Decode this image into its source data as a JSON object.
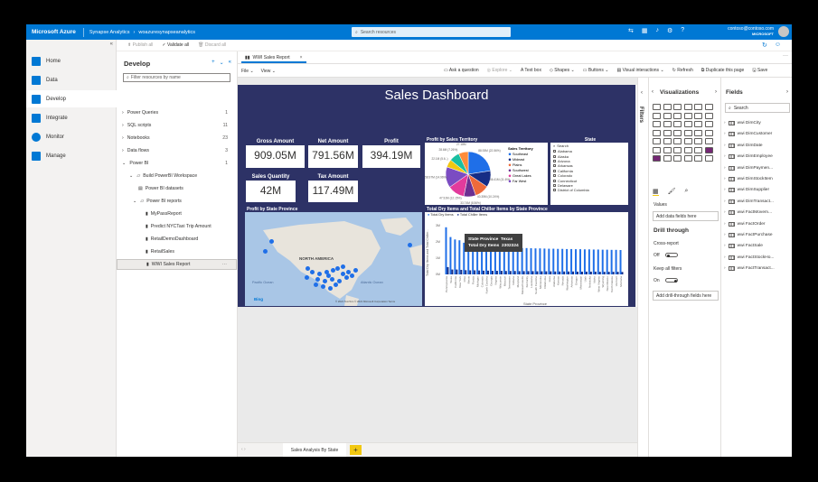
{
  "topbar": {
    "brand": "Microsoft Azure",
    "product": "Synapse Analytics",
    "workspace": "woazuresynapseanalytics",
    "search_placeholder": "Search resources",
    "user_email": "contoso@contoso.com",
    "user_directory": "MICROSOFT"
  },
  "cmdbar": {
    "publish_all": "Publish all",
    "validate_all": "Validate all",
    "discard_all": "Discard all"
  },
  "leftnav": {
    "items": [
      {
        "label": "Home",
        "icon": "home-icon"
      },
      {
        "label": "Data",
        "icon": "data-icon"
      },
      {
        "label": "Develop",
        "icon": "develop-icon"
      },
      {
        "label": "Integrate",
        "icon": "integrate-icon"
      },
      {
        "label": "Monitor",
        "icon": "monitor-icon"
      },
      {
        "label": "Manage",
        "icon": "manage-icon"
      }
    ],
    "active": "Develop"
  },
  "develop": {
    "title": "Develop",
    "filter_placeholder": "Filter resources by name",
    "tree": [
      {
        "label": "Power Queries",
        "count": "1"
      },
      {
        "label": "SQL scripts",
        "count": "11"
      },
      {
        "label": "Notebooks",
        "count": "23"
      },
      {
        "label": "Data flows",
        "count": "3"
      },
      {
        "label": "Power BI",
        "count": "1"
      },
      {
        "label": "Build PowerBI Workspace"
      },
      {
        "label": "Power BI datasets"
      },
      {
        "label": "Power BI reports"
      },
      {
        "label": "MyPassReport"
      },
      {
        "label": "Predict NYCTaxi Trip Amount"
      },
      {
        "label": "RetailDemoDashboard"
      },
      {
        "label": "RetailSales"
      },
      {
        "label": "WWI Sales Report"
      }
    ]
  },
  "report_tab": {
    "label": "WWI Sales Report"
  },
  "ribbon": {
    "file": "File",
    "view": "View",
    "ask": "Ask a question",
    "explore": "Explore",
    "textbox": "Text box",
    "shapes": "Shapes",
    "buttons": "Buttons",
    "visual_interactions": "Visual interactions",
    "refresh": "Refresh",
    "duplicate": "Duplicate this page",
    "save": "Save"
  },
  "dashboard": {
    "title": "Sales Dashboard",
    "kpis": [
      {
        "label": "Gross Amount",
        "value": "909.05M"
      },
      {
        "label": "Net Amount",
        "value": "791.56M"
      },
      {
        "label": "Profit",
        "value": "394.19M"
      },
      {
        "label": "Sales Quantity",
        "value": "42M"
      },
      {
        "label": "Tax Amount",
        "value": "117.49M"
      }
    ],
    "pie_title": "Profit by Sales Territory",
    "pie_legend_title": "Sales Territory",
    "slicer_title": "State",
    "slicer_search": "Search",
    "slicer_items": [
      "Alabama",
      "Alaska",
      "Arizona",
      "Arkansas",
      "California",
      "Colorado",
      "Connecticut",
      "Delaware",
      "District of Columbia"
    ],
    "map_title": "Profit by State Province",
    "map_labels": {
      "na": "NORTH AMERICA",
      "pac": "Pacific Ocean",
      "atl": "Atlantic Ocean",
      "bing": "Bing",
      "copy": "© 2021 TomTom © 2021 Microsoft Corporation Terms"
    },
    "bar_title": "Total Dry Items and Total Chiller Items by State Province",
    "bar_legend": [
      "Total Dry Items",
      "Total Chiller Items"
    ],
    "bar_xlabel": "State Province",
    "bar_ylabel": "Total Dry Items and Total Chiller...",
    "tooltip": {
      "k1": "State Province",
      "v1": "Texas",
      "k2": "Total Dry Items",
      "v2": "2302324"
    }
  },
  "chart_data": [
    {
      "type": "pie",
      "title": "Profit by Sales Territory",
      "legend_title": "Sales Territory",
      "categories": [
        "Southeast",
        "Mideast",
        "Plains",
        "Southwest",
        "Great Lakes",
        "Far West",
        "New England",
        "Rocky Mountain",
        "External"
      ],
      "values": [
        88.93,
        46.41,
        40.35,
        33.74,
        47.91,
        58.97,
        22.1,
        28.6,
        27.18
      ],
      "colors": [
        "#1f6fe8",
        "#162d85",
        "#ef6a3a",
        "#6b2f91",
        "#e23b9c",
        "#7b4cc2",
        "#f2c811",
        "#1bbfa1",
        "#ff8c3a"
      ],
      "data_labels": [
        "88.93M (22.56%)",
        "46.41M (11.6%)",
        "40.35M (10.24%)",
        "33.74M (8.56%)",
        "47.91M (12.15%)",
        "58.97M (14.96%)",
        "22.1M (5.6..)",
        "28.6M (7.26%)",
        "27.18M"
      ]
    },
    {
      "type": "bar",
      "title": "Total Dry Items and Total Chiller Items by State Province",
      "categories": [
        "Pennsylvania",
        "Texas",
        "California",
        "New York",
        "Ohio",
        "Illinois",
        "Florida",
        "Michigan",
        "Colorado",
        "North Carolina",
        "Georgia",
        "Virginia",
        "Wisconsin",
        "Missouri",
        "Tennessee",
        "Indiana",
        "Maryland",
        "Massachusetts",
        "Kentucky",
        "Louisiana",
        "South Carolina",
        "Minnesota",
        "Oklahoma",
        "Iowa",
        "Alabama",
        "Kansas",
        "Nevada",
        "Washington",
        "Arkansas",
        "Oregon",
        "Mississippi",
        "Utah",
        "Nebraska",
        "Idaho",
        "West Virginia",
        "Wyoming",
        "New Mexico",
        "North Dakota",
        "Vermont",
        "Montana"
      ],
      "series": [
        {
          "name": "Total Dry Items",
          "values": [
            2.9,
            2.3,
            2.15,
            2.1,
            1.95,
            1.9,
            1.85,
            1.8,
            1.78,
            1.75,
            1.72,
            1.7,
            1.68,
            1.66,
            1.65,
            1.64,
            1.63,
            1.62,
            1.62,
            1.61,
            1.6,
            1.6,
            1.59,
            1.58,
            1.58,
            1.57,
            1.57,
            1.56,
            1.56,
            1.55,
            1.55,
            1.54,
            1.54,
            1.53,
            1.53,
            1.52,
            1.52,
            1.51,
            1.51,
            1.5
          ],
          "color": "#1f6fe8"
        },
        {
          "name": "Total Chiller Items",
          "values": [
            0.45,
            0.3,
            0.3,
            0.28,
            0.26,
            0.25,
            0.25,
            0.24,
            0.23,
            0.23,
            0.22,
            0.22,
            0.22,
            0.21,
            0.21,
            0.21,
            0.2,
            0.2,
            0.2,
            0.2,
            0.19,
            0.19,
            0.19,
            0.19,
            0.18,
            0.18,
            0.18,
            0.18,
            0.18,
            0.17,
            0.17,
            0.17,
            0.17,
            0.17,
            0.16,
            0.16,
            0.16,
            0.16,
            0.16,
            0.15
          ],
          "color": "#162d85"
        }
      ],
      "yticks": [
        "0M",
        "1M",
        "2M",
        "3M"
      ],
      "ylim": [
        0,
        3
      ],
      "xlabel": "State Province",
      "ylabel": "Total Dry Items and Total Chiller..."
    }
  ],
  "page_tab": {
    "label": "Sales Analysis By State",
    "add": "+"
  },
  "filters": {
    "label": "Filters"
  },
  "viz_pane": {
    "title": "Visualizations",
    "values_label": "Values",
    "add_fields": "Add data fields here",
    "drill_title": "Drill through",
    "cross_report": "Cross-report",
    "cross_state": "Off",
    "keep_filters": "Keep all filters",
    "keep_state": "On",
    "add_drill": "Add drill-through fields here"
  },
  "fields_pane": {
    "title": "Fields",
    "search": "Search",
    "tables": [
      "wwi DimCity",
      "wwi DimCustomer",
      "wwi DimDate",
      "wwi DimEmployee",
      "wwi DimPaymen...",
      "wwi DimStockItem",
      "wwi DimSupplier",
      "wwi DimTransact...",
      "wwi FactMovem...",
      "wwi FactOrder",
      "wwi FactPurchase",
      "wwi FactSale",
      "wwi FactStockHo...",
      "wwi FactTransact..."
    ]
  }
}
